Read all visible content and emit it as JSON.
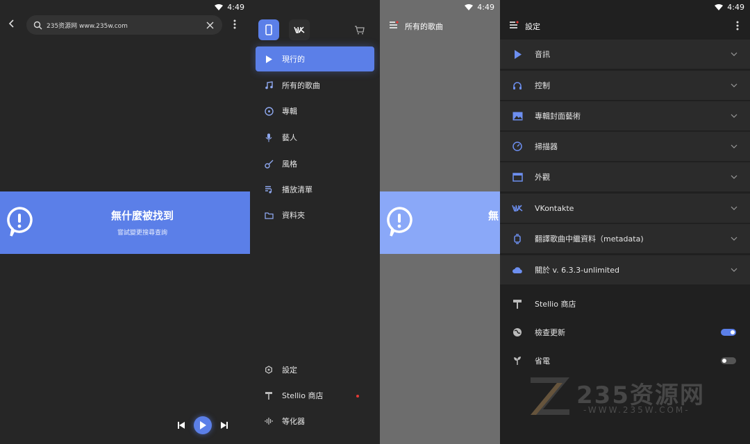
{
  "status": {
    "time": "4:49"
  },
  "search": {
    "query": "235资源网  www.235w.com"
  },
  "empty_state": {
    "title": "無什麼被找到",
    "subtitle": "嘗試變更搜尋查詢"
  },
  "drawer": {
    "items": [
      {
        "label": "現行的",
        "icon": "play-icon",
        "active": true
      },
      {
        "label": "所有的歌曲",
        "icon": "music-note-icon"
      },
      {
        "label": "專輯",
        "icon": "disc-icon"
      },
      {
        "label": "藝人",
        "icon": "microphone-icon"
      },
      {
        "label": "風格",
        "icon": "guitar-icon"
      },
      {
        "label": "播放清單",
        "icon": "playlist-icon"
      },
      {
        "label": "資料夾",
        "icon": "folder-icon"
      }
    ],
    "bottom_items": [
      {
        "label": "設定",
        "icon": "settings-icon"
      },
      {
        "label": "Stellio 商店",
        "icon": "paint-roller-icon"
      },
      {
        "label": "等化器",
        "icon": "equalizer-icon"
      }
    ]
  },
  "panel3": {
    "title": "所有的歌曲",
    "banner_title": "無"
  },
  "settings": {
    "title": "設定",
    "sections": [
      {
        "label": "音訊",
        "icon": "play-icon"
      },
      {
        "label": "控制",
        "icon": "headphones-icon"
      },
      {
        "label": "專輯封面藝術",
        "icon": "image-icon"
      },
      {
        "label": "掃描器",
        "icon": "scanner-icon"
      },
      {
        "label": "外觀",
        "icon": "window-icon"
      },
      {
        "label": "VKontakte",
        "icon": "vk-icon"
      },
      {
        "label": "翻譯歌曲中繼資料（metadata)",
        "icon": "watch-icon"
      },
      {
        "label": "關於 v. 6.3.3-unlimited",
        "icon": "cloud-icon"
      }
    ],
    "extras": [
      {
        "label": "Stellio 商店",
        "icon": "paint-roller-icon"
      },
      {
        "label": "檢查更新",
        "icon": "globe-icon",
        "toggle": true
      },
      {
        "label": "省電",
        "icon": "plant-icon",
        "toggle": false
      }
    ]
  },
  "watermark": {
    "text": "235资源网",
    "sub": "-WWW.235W.COM-"
  },
  "colors": {
    "accent": "#5b7fe8",
    "panel": "#2b2b2b",
    "background": "#202020"
  }
}
